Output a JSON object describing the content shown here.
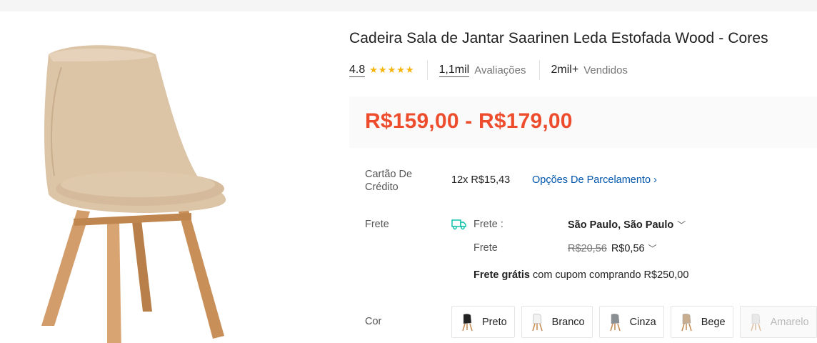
{
  "product": {
    "title": "Cadeira Sala de Jantar Saarinen Leda Estofada Wood - Cores",
    "rating": "4.8",
    "stars": 5,
    "reviews_count": "1,1mil",
    "reviews_label": "Avaliações",
    "sold_count": "2mil+",
    "sold_label": "Vendidos",
    "price": "R$159,00 - R$179,00"
  },
  "installment": {
    "label": "Cartão De Crédito",
    "value": "12x R$15,43",
    "link": "Opções De Parcelamento"
  },
  "shipping": {
    "label": "Frete",
    "to_label": "Frete :",
    "location": "São Paulo, São Paulo",
    "fee_label": "Frete",
    "fee_old": "R$20,56",
    "fee_new": "R$0,56",
    "free_bold": "Frete grátis",
    "free_rest": " com cupom comprando R$250,00"
  },
  "colors": {
    "label": "Cor",
    "options": [
      {
        "name": "Preto",
        "seat": "#222222",
        "available": true
      },
      {
        "name": "Branco",
        "seat": "#f2f2f2",
        "available": true
      },
      {
        "name": "Cinza",
        "seat": "#8a8f94",
        "available": true
      },
      {
        "name": "Bege",
        "seat": "#c9ad8f",
        "available": true
      },
      {
        "name": "Amarelo",
        "seat": "#d8d8d8",
        "available": false
      }
    ]
  },
  "theme": {
    "price_color": "#ee4d2d",
    "star_color": "#f5b50b",
    "link_color": "#0055aa",
    "chair_color": "#dcc4a6",
    "wood_color": "#d19a66"
  }
}
